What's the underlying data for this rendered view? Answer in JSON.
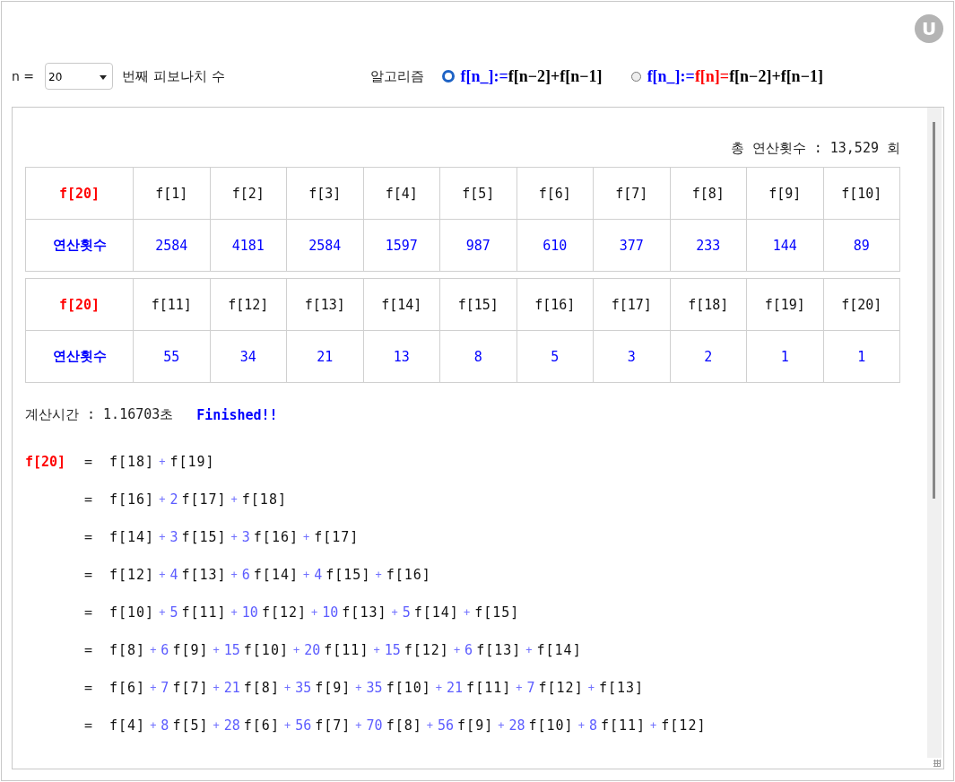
{
  "badge": "U",
  "controls": {
    "n_label": "n =",
    "n_select": "20",
    "n_suffix": "번째 피보나치 수",
    "algorithm_label": "알고리즘",
    "algorithms": [
      {
        "selected": true,
        "parts": [
          {
            "text": "f[n_]:=",
            "color": "#0000ff"
          },
          {
            "text": "f[n−2]+f[n−1]",
            "color": "#000000"
          }
        ]
      },
      {
        "selected": false,
        "parts": [
          {
            "text": "f[n_]:=",
            "color": "#0000ff"
          },
          {
            "text": "f[n]=",
            "color": "#ff0000"
          },
          {
            "text": "f[n−2]+f[n−1]",
            "color": "#000000"
          }
        ]
      }
    ]
  },
  "total": "총 연산횟수 : 13,529 회",
  "tables": [
    {
      "corner": "f[20]",
      "row_label": "연산횟수",
      "columns": [
        "f[1]",
        "f[2]",
        "f[3]",
        "f[4]",
        "f[5]",
        "f[6]",
        "f[7]",
        "f[8]",
        "f[9]",
        "f[10]"
      ],
      "values": [
        "2584",
        "4181",
        "2584",
        "1597",
        "987",
        "610",
        "377",
        "233",
        "144",
        "89"
      ]
    },
    {
      "corner": "f[20]",
      "row_label": "연산횟수",
      "columns": [
        "f[11]",
        "f[12]",
        "f[13]",
        "f[14]",
        "f[15]",
        "f[16]",
        "f[17]",
        "f[18]",
        "f[19]",
        "f[20]"
      ],
      "values": [
        "55",
        "34",
        "21",
        "13",
        "8",
        "5",
        "3",
        "2",
        "1",
        "1"
      ]
    }
  ],
  "time": "계산시간 : 1.16703초",
  "status": "Finished!!",
  "equation": {
    "lhs": "f[20]",
    "lines": [
      {
        "eq": "=",
        "terms": [
          {
            "f": "f[18]"
          },
          {
            "op": "+",
            "f": "f[19]"
          }
        ]
      },
      {
        "eq": "=",
        "terms": [
          {
            "f": "f[16]"
          },
          {
            "op": "+",
            "coef": "2",
            "f": "f[17]"
          },
          {
            "op": "+",
            "f": "f[18]"
          }
        ]
      },
      {
        "eq": "=",
        "terms": [
          {
            "f": "f[14]"
          },
          {
            "op": "+",
            "coef": "3",
            "f": "f[15]"
          },
          {
            "op": "+",
            "coef": "3",
            "f": "f[16]"
          },
          {
            "op": "+",
            "f": "f[17]"
          }
        ]
      },
      {
        "eq": "=",
        "terms": [
          {
            "f": "f[12]"
          },
          {
            "op": "+",
            "coef": "4",
            "f": "f[13]"
          },
          {
            "op": "+",
            "coef": "6",
            "f": "f[14]"
          },
          {
            "op": "+",
            "coef": "4",
            "f": "f[15]"
          },
          {
            "op": "+",
            "f": "f[16]"
          }
        ]
      },
      {
        "eq": "=",
        "terms": [
          {
            "f": "f[10]"
          },
          {
            "op": "+",
            "coef": "5",
            "f": "f[11]"
          },
          {
            "op": "+",
            "coef": "10",
            "f": "f[12]"
          },
          {
            "op": "+",
            "coef": "10",
            "f": "f[13]"
          },
          {
            "op": "+",
            "coef": "5",
            "f": "f[14]"
          },
          {
            "op": "+",
            "f": "f[15]"
          }
        ]
      },
      {
        "eq": "=",
        "terms": [
          {
            "f": "f[8]"
          },
          {
            "op": "+",
            "coef": "6",
            "f": "f[9]"
          },
          {
            "op": "+",
            "coef": "15",
            "f": "f[10]"
          },
          {
            "op": "+",
            "coef": "20",
            "f": "f[11]"
          },
          {
            "op": "+",
            "coef": "15",
            "f": "f[12]"
          },
          {
            "op": "+",
            "coef": "6",
            "f": "f[13]"
          },
          {
            "op": "+",
            "f": "f[14]"
          }
        ]
      },
      {
        "eq": "=",
        "terms": [
          {
            "f": "f[6]"
          },
          {
            "op": "+",
            "coef": "7",
            "f": "f[7]"
          },
          {
            "op": "+",
            "coef": "21",
            "f": "f[8]"
          },
          {
            "op": "+",
            "coef": "35",
            "f": "f[9]"
          },
          {
            "op": "+",
            "coef": "35",
            "f": "f[10]"
          },
          {
            "op": "+",
            "coef": "21",
            "f": "f[11]"
          },
          {
            "op": "+",
            "coef": "7",
            "f": "f[12]"
          },
          {
            "op": "+",
            "f": "f[13]"
          }
        ]
      },
      {
        "eq": "=",
        "terms": [
          {
            "f": "f[4]"
          },
          {
            "op": "+",
            "coef": "8",
            "f": "f[5]"
          },
          {
            "op": "+",
            "coef": "28",
            "f": "f[6]"
          },
          {
            "op": "+",
            "coef": "56",
            "f": "f[7]"
          },
          {
            "op": "+",
            "coef": "70",
            "f": "f[8]"
          },
          {
            "op": "+",
            "coef": "56",
            "f": "f[9]"
          },
          {
            "op": "+",
            "coef": "28",
            "f": "f[10]"
          },
          {
            "op": "+",
            "coef": "8",
            "f": "f[11]"
          },
          {
            "op": "+",
            "f": "f[12]"
          }
        ]
      }
    ]
  }
}
